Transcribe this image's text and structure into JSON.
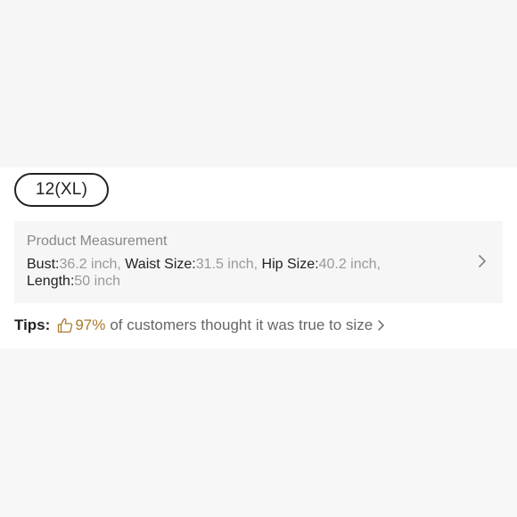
{
  "size_chip": {
    "label": "12(XL)"
  },
  "measurement": {
    "title": "Product Measurement",
    "items": [
      {
        "label": "Bust:",
        "value": "36.2 inch"
      },
      {
        "label": "Waist Size:",
        "value": "31.5 inch"
      },
      {
        "label": "Hip Size:",
        "value": "40.2 inch"
      },
      {
        "label": "Length:",
        "value": "50 inch"
      }
    ],
    "chevron_icon": "chevron-right-icon"
  },
  "tips": {
    "label": "Tips:",
    "icon": "thumbs-up-icon",
    "percent": "97%",
    "message": "of customers thought it was true to size",
    "chevron_icon": "chevron-right-icon",
    "accent_color": "#a87a2c"
  }
}
